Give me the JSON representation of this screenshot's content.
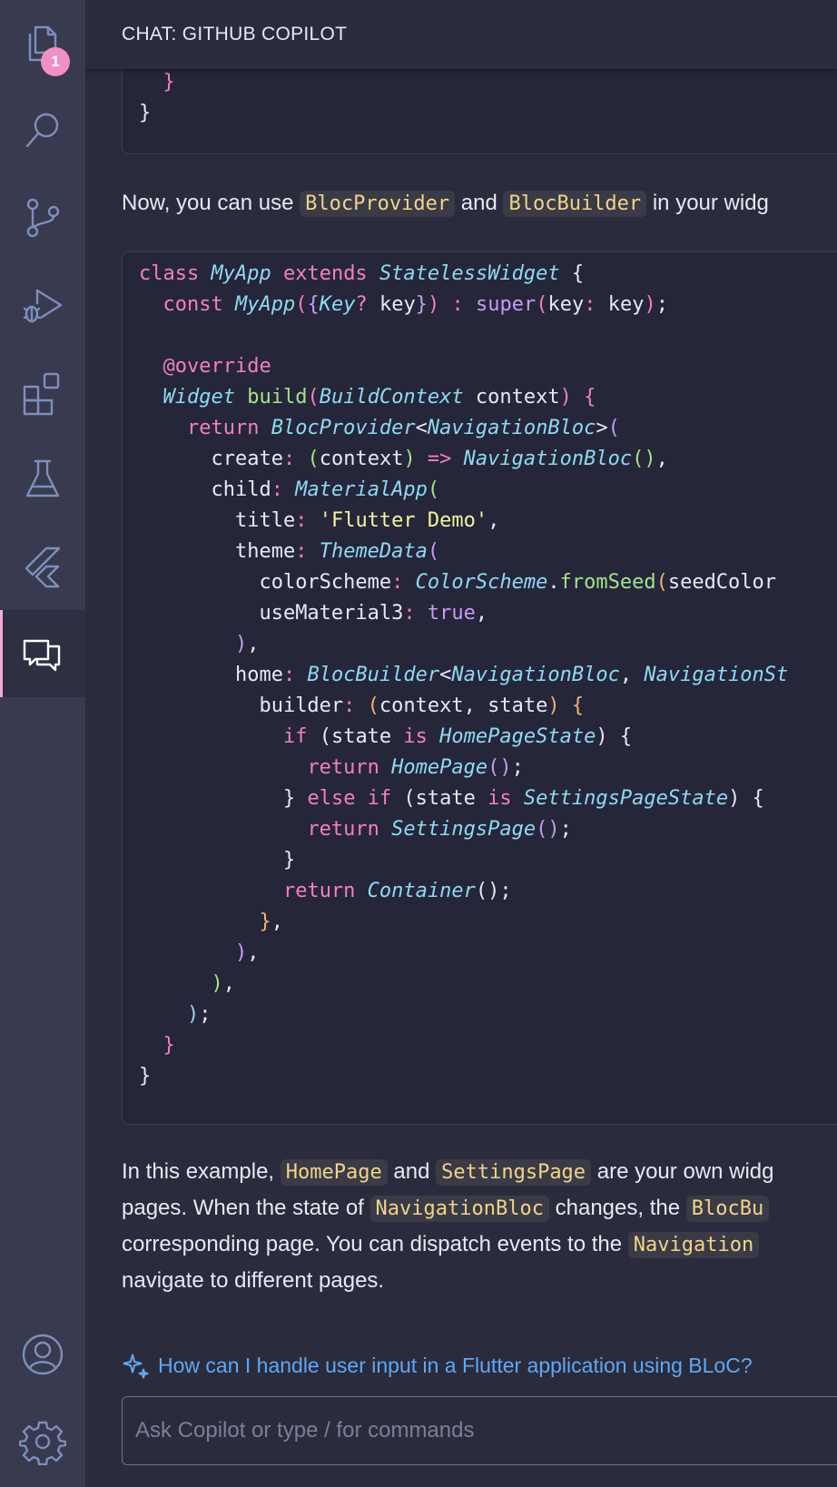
{
  "activity_bar": {
    "explorer_badge": "1",
    "items": [
      "explorer-icon",
      "search-icon",
      "source-control-icon",
      "run-debug-icon",
      "extensions-icon",
      "testing-icon",
      "flutter-icon",
      "chat-icon"
    ],
    "bottom": [
      "account-icon",
      "settings-gear-icon"
    ]
  },
  "header": {
    "title": "CHAT: GITHUB COPILOT"
  },
  "chat": {
    "prev_code_tail": [
      "  }",
      "}"
    ],
    "para1": {
      "t1": "Now, you can use ",
      "c1": "BlocProvider",
      "t2": " and ",
      "c2": "BlocBuilder",
      "t3": " in your widg"
    },
    "para2": {
      "line1": {
        "t1": "In this example, ",
        "c1": "HomePage",
        "t2": " and ",
        "c2": "SettingsPage",
        "t3": " are your own widg"
      },
      "line2": {
        "t1": "pages. When the state of ",
        "c1": "NavigationBloc",
        "t2": " changes, the ",
        "c2": "BlocBu"
      },
      "line3": {
        "t1": "corresponding page. You can dispatch events to the ",
        "c1": "Navigation"
      },
      "line4": {
        "t1": "navigate to different pages."
      }
    },
    "suggestion": "How can I handle user input in a Flutter application using BLoC?",
    "input_placeholder": "Ask Copilot or type / for commands"
  },
  "code_lines": [
    [
      [
        "class ",
        "kw"
      ],
      [
        "MyApp",
        "ty"
      ],
      [
        " extends ",
        "kw"
      ],
      [
        "StatelessWidget",
        "ty"
      ],
      [
        " {",
        "pl"
      ]
    ],
    [
      [
        "  ",
        "pl"
      ],
      [
        "const ",
        "kw"
      ],
      [
        "MyApp",
        "ty"
      ],
      [
        "(",
        "b1"
      ],
      [
        "{",
        "b2"
      ],
      [
        "Key",
        "ty"
      ],
      [
        "? ",
        "pu"
      ],
      [
        "key",
        "pl"
      ],
      [
        "}",
        "b2"
      ],
      [
        ") ",
        "b1"
      ],
      [
        ": ",
        "pu"
      ],
      [
        "super",
        "pa"
      ],
      [
        "(",
        "b1"
      ],
      [
        "key",
        "pl"
      ],
      [
        ": ",
        "pu"
      ],
      [
        "key",
        "pl"
      ],
      [
        ")",
        "b1"
      ],
      [
        ";",
        "pl"
      ]
    ],
    [],
    [
      [
        "  ",
        "pl"
      ],
      [
        "@override",
        "an"
      ]
    ],
    [
      [
        "  ",
        "pl"
      ],
      [
        "Widget",
        "ty"
      ],
      [
        " ",
        "pl"
      ],
      [
        "build",
        "fn"
      ],
      [
        "(",
        "b1"
      ],
      [
        "BuildContext",
        "ty"
      ],
      [
        " context",
        "pl"
      ],
      [
        ")",
        "b1"
      ],
      [
        " {",
        "b1"
      ]
    ],
    [
      [
        "    ",
        "pl"
      ],
      [
        "return ",
        "kw"
      ],
      [
        "BlocProvider",
        "ty"
      ],
      [
        "<",
        "pl"
      ],
      [
        "NavigationBloc",
        "ty"
      ],
      [
        ">",
        "pl"
      ],
      [
        "(",
        "b2"
      ]
    ],
    [
      [
        "      ",
        "pl"
      ],
      [
        "create",
        "pl"
      ],
      [
        ": ",
        "pu"
      ],
      [
        "(",
        "b3"
      ],
      [
        "context",
        "pl"
      ],
      [
        ")",
        "b3"
      ],
      [
        " => ",
        "pu"
      ],
      [
        "NavigationBloc",
        "ty"
      ],
      [
        "()",
        "b3"
      ],
      [
        ",",
        "pl"
      ]
    ],
    [
      [
        "      ",
        "pl"
      ],
      [
        "child",
        "pl"
      ],
      [
        ": ",
        "pu"
      ],
      [
        "MaterialApp",
        "ty"
      ],
      [
        "(",
        "b3"
      ]
    ],
    [
      [
        "        ",
        "pl"
      ],
      [
        "title",
        "pl"
      ],
      [
        ": ",
        "pu"
      ],
      [
        "'Flutter Demo'",
        "st"
      ],
      [
        ",",
        "pl"
      ]
    ],
    [
      [
        "        ",
        "pl"
      ],
      [
        "theme",
        "pl"
      ],
      [
        ": ",
        "pu"
      ],
      [
        "ThemeData",
        "ty"
      ],
      [
        "(",
        "b2"
      ]
    ],
    [
      [
        "          ",
        "pl"
      ],
      [
        "colorScheme",
        "pl"
      ],
      [
        ": ",
        "pu"
      ],
      [
        "ColorScheme",
        "ty"
      ],
      [
        ".",
        "pl"
      ],
      [
        "fromSeed",
        "fn"
      ],
      [
        "(",
        "b4"
      ],
      [
        "seedColor",
        "pl"
      ]
    ],
    [
      [
        "          ",
        "pl"
      ],
      [
        "useMaterial3",
        "pl"
      ],
      [
        ": ",
        "pu"
      ],
      [
        "true",
        "bo"
      ],
      [
        ",",
        "pl"
      ]
    ],
    [
      [
        "        ",
        "pl"
      ],
      [
        ")",
        "b2"
      ],
      [
        ",",
        "pl"
      ]
    ],
    [
      [
        "        ",
        "pl"
      ],
      [
        "home",
        "pl"
      ],
      [
        ": ",
        "pu"
      ],
      [
        "BlocBuilder",
        "ty"
      ],
      [
        "<",
        "pl"
      ],
      [
        "NavigationBloc",
        "ty"
      ],
      [
        ", ",
        "pl"
      ],
      [
        "NavigationSt",
        "ty"
      ]
    ],
    [
      [
        "          ",
        "pl"
      ],
      [
        "builder",
        "pl"
      ],
      [
        ": ",
        "pu"
      ],
      [
        "(",
        "b4"
      ],
      [
        "context, state",
        "pl"
      ],
      [
        ")",
        "b4"
      ],
      [
        " {",
        "b4"
      ]
    ],
    [
      [
        "            ",
        "pl"
      ],
      [
        "if ",
        "kw"
      ],
      [
        "(state ",
        "pl"
      ],
      [
        "is ",
        "kw"
      ],
      [
        "HomePageState",
        "ty"
      ],
      [
        ") {",
        "pl"
      ]
    ],
    [
      [
        "              ",
        "pl"
      ],
      [
        "return ",
        "kw"
      ],
      [
        "HomePage",
        "ty"
      ],
      [
        "()",
        "b2"
      ],
      [
        ";",
        "pl"
      ]
    ],
    [
      [
        "            ",
        "pl"
      ],
      [
        "} ",
        "pl"
      ],
      [
        "else if ",
        "kw"
      ],
      [
        "(state ",
        "pl"
      ],
      [
        "is ",
        "kw"
      ],
      [
        "SettingsPageState",
        "ty"
      ],
      [
        ") {",
        "pl"
      ]
    ],
    [
      [
        "              ",
        "pl"
      ],
      [
        "return ",
        "kw"
      ],
      [
        "SettingsPage",
        "ty"
      ],
      [
        "()",
        "b2"
      ],
      [
        ";",
        "pl"
      ]
    ],
    [
      [
        "            ",
        "pl"
      ],
      [
        "}",
        "pl"
      ]
    ],
    [
      [
        "            ",
        "pl"
      ],
      [
        "return ",
        "kw"
      ],
      [
        "Container",
        "ty"
      ],
      [
        "();",
        "pl"
      ]
    ],
    [
      [
        "          ",
        "pl"
      ],
      [
        "}",
        "b4"
      ],
      [
        ",",
        "pl"
      ]
    ],
    [
      [
        "        ",
        "pl"
      ],
      [
        ")",
        "b2"
      ],
      [
        ",",
        "pl"
      ]
    ],
    [
      [
        "      ",
        "pl"
      ],
      [
        ")",
        "b3"
      ],
      [
        ",",
        "pl"
      ]
    ],
    [
      [
        "    ",
        "pl"
      ],
      [
        ")",
        "b5"
      ],
      [
        ";",
        "pl"
      ]
    ],
    [
      [
        "  ",
        "pl"
      ],
      [
        "}",
        "b1"
      ]
    ],
    [
      [
        "}",
        "pl"
      ]
    ]
  ]
}
